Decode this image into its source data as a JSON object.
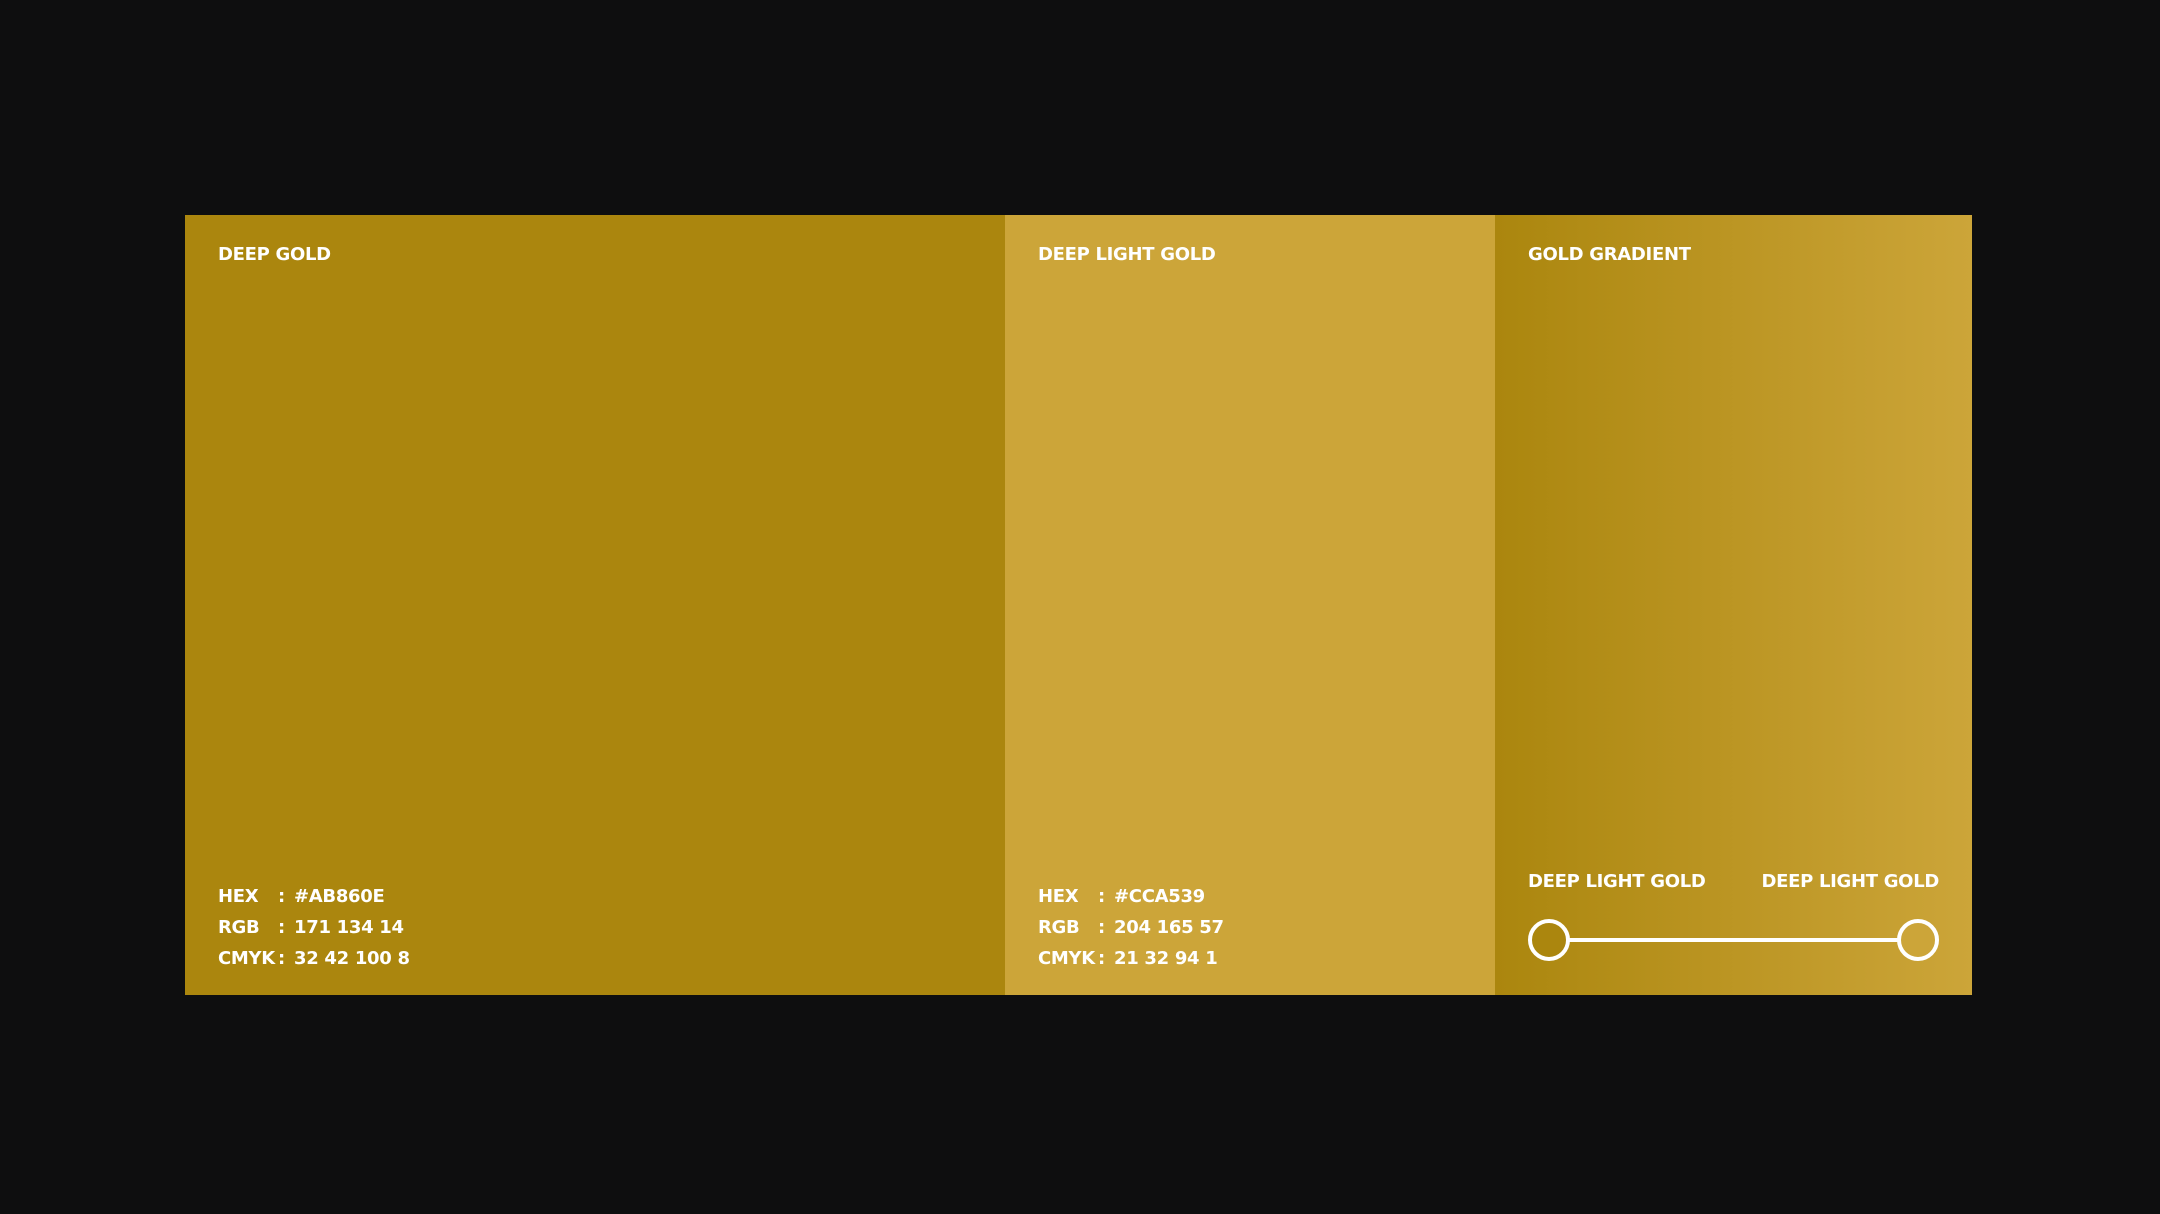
{
  "swatches": {
    "deep_gold": {
      "title": "DEEP GOLD",
      "color": "#AB860E",
      "hex_label": "HEX",
      "hex_value": "#AB860E",
      "rgb_label": "RGB",
      "rgb_value": "171 134 14",
      "cmyk_label": "CMYK",
      "cmyk_value": "32 42 100 8",
      "separator": ":"
    },
    "deep_light_gold": {
      "title": "DEEP LIGHT GOLD",
      "color": "#CCA539",
      "hex_label": "HEX",
      "hex_value": "#CCA539",
      "rgb_label": "RGB",
      "rgb_value": "204 165 57",
      "cmyk_label": "CMYK",
      "cmyk_value": "21 32 94 1",
      "separator": ":"
    },
    "gold_gradient": {
      "title": "GOLD GRADIENT",
      "start_label": "DEEP LIGHT GOLD",
      "end_label": "DEEP LIGHT GOLD",
      "start_color": "#AB860E",
      "end_color": "#CCA539"
    }
  },
  "background_color": "#0E0E0F"
}
